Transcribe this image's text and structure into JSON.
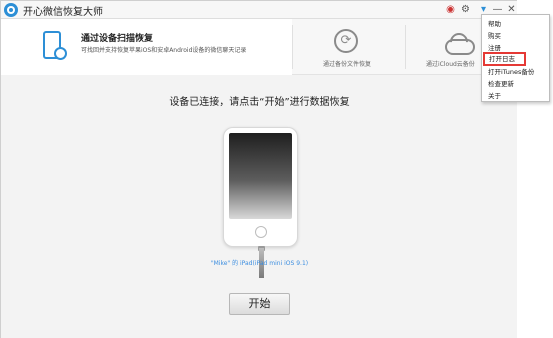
{
  "window": {
    "title": "开心微信恢复大师"
  },
  "titlebar_icons": [
    "weibo-icon",
    "gear-icon",
    "menu-icon",
    "minimize-icon",
    "close-icon"
  ],
  "modes": {
    "active": {
      "title": "通过设备扫描恢复",
      "description": "可找回并支持恢复苹果iOS和安卓Android设备的微信聊天记录"
    },
    "backup": {
      "label": "通过备份文件恢复"
    },
    "icloud": {
      "label": "通过iCloud云备份"
    }
  },
  "main": {
    "heading": "设备已连接，请点击“开始”进行数据恢复",
    "device_label": "\"Mike\" 的 iPad(iPad mini iOS 9.1)",
    "start_button": "开始"
  },
  "menu": {
    "items": [
      "帮助",
      "购买",
      "注册",
      "打开日志",
      "打开iTunes备份",
      "检查更新",
      "关于"
    ],
    "highlighted_index": 3
  },
  "colors": {
    "accent": "#2d8fd6",
    "highlight_border": "#e53935",
    "device_label": "#3c8ee0"
  }
}
